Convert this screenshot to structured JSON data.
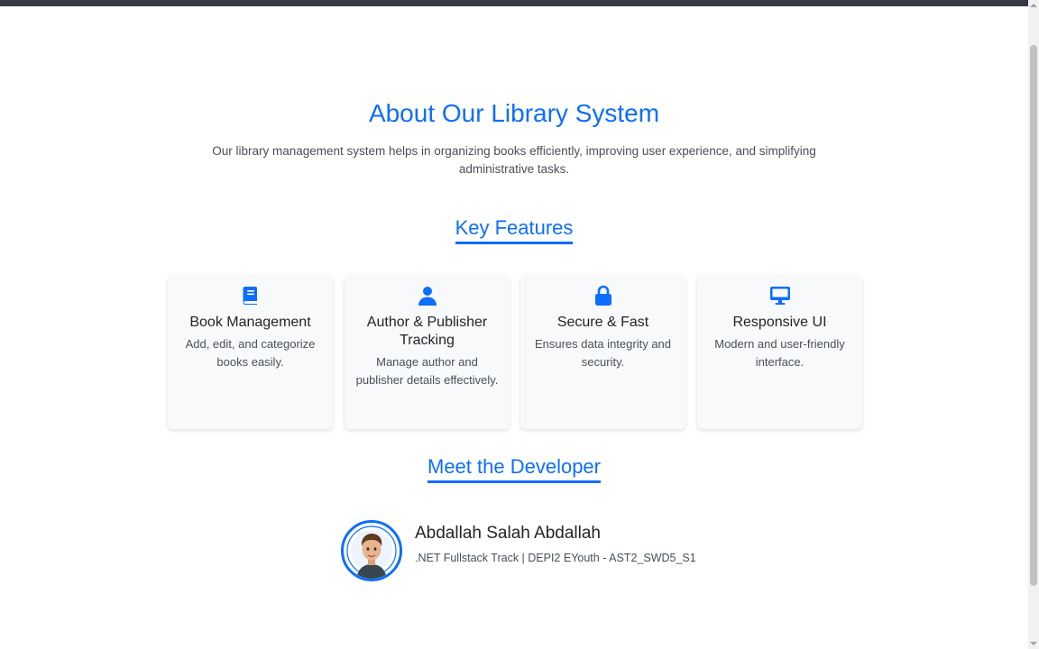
{
  "about": {
    "title": "About Our Library System",
    "description": "Our library management system helps in organizing books efficiently, improving user experience, and simplifying administrative tasks."
  },
  "features": {
    "heading": "Key Features",
    "items": [
      {
        "icon": "book-icon",
        "title": "Book Management",
        "text": "Add, edit, and categorize books easily."
      },
      {
        "icon": "user-icon",
        "title": "Author & Publisher Tracking",
        "text": "Manage author and publisher details effectively."
      },
      {
        "icon": "lock-icon",
        "title": "Secure & Fast",
        "text": "Ensures data integrity and security."
      },
      {
        "icon": "monitor-icon",
        "title": "Responsive UI",
        "text": "Modern and user-friendly interface."
      }
    ]
  },
  "developer": {
    "heading": "Meet the Developer",
    "name": "Abdallah Salah Abdallah",
    "role": ".NET Fullstack Track | DEPI2 EYouth - AST2_SWD5_S1"
  },
  "colors": {
    "accent": "#0d6efd",
    "card_bg": "#f8f9fa",
    "navbar": "#343a40"
  }
}
